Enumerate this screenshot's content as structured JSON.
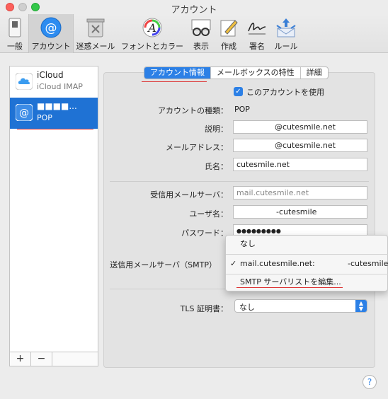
{
  "window": {
    "title": "アカウント"
  },
  "toolbar": {
    "items": [
      {
        "label": "一般",
        "icon": "switch-icon"
      },
      {
        "label": "アカウント",
        "icon": "at-icon"
      },
      {
        "label": "迷惑メール",
        "icon": "trash-icon"
      },
      {
        "label": "フォントとカラー",
        "icon": "font-icon"
      },
      {
        "label": "表示",
        "icon": "glasses-icon"
      },
      {
        "label": "作成",
        "icon": "pencil-icon"
      },
      {
        "label": "署名",
        "icon": "signature-icon"
      },
      {
        "label": "ルール",
        "icon": "rules-icon"
      }
    ]
  },
  "sidebar": {
    "accounts": [
      {
        "name": "iCloud",
        "type": "iCloud IMAP"
      },
      {
        "name": "■■■■...",
        "type": "POP"
      }
    ],
    "add_label": "+",
    "remove_label": "−"
  },
  "tabs": [
    "アカウント情報",
    "メールボックスの特性",
    "詳細"
  ],
  "form": {
    "enable_label": "このアカウントを使用",
    "account_type_label": "アカウントの種類：",
    "account_type_value": "POP",
    "description_label": "説明：",
    "description_value": "@cutesmile.net",
    "email_label": "メールアドレス：",
    "email_value": "@cutesmile.net",
    "fullname_label": "氏名：",
    "fullname_value": "cutesmile.net",
    "incoming_label": "受信用メールサーバ：",
    "incoming_value": "mail.cutesmile.net",
    "username_label": "ユーザ名：",
    "username_value": "-cutesmile",
    "password_label": "パスワード：",
    "password_value": "●●●●●●●●●",
    "smtp_label": "送信用メールサーバ（SMTP）",
    "tls_label": "TLS 証明書：",
    "tls_value": "なし"
  },
  "smtp_menu": {
    "none": "なし",
    "server": "mail.cutesmile.net:",
    "server_user": "-cutesmile",
    "edit": "SMTP サーバリストを編集..."
  },
  "help": "?"
}
